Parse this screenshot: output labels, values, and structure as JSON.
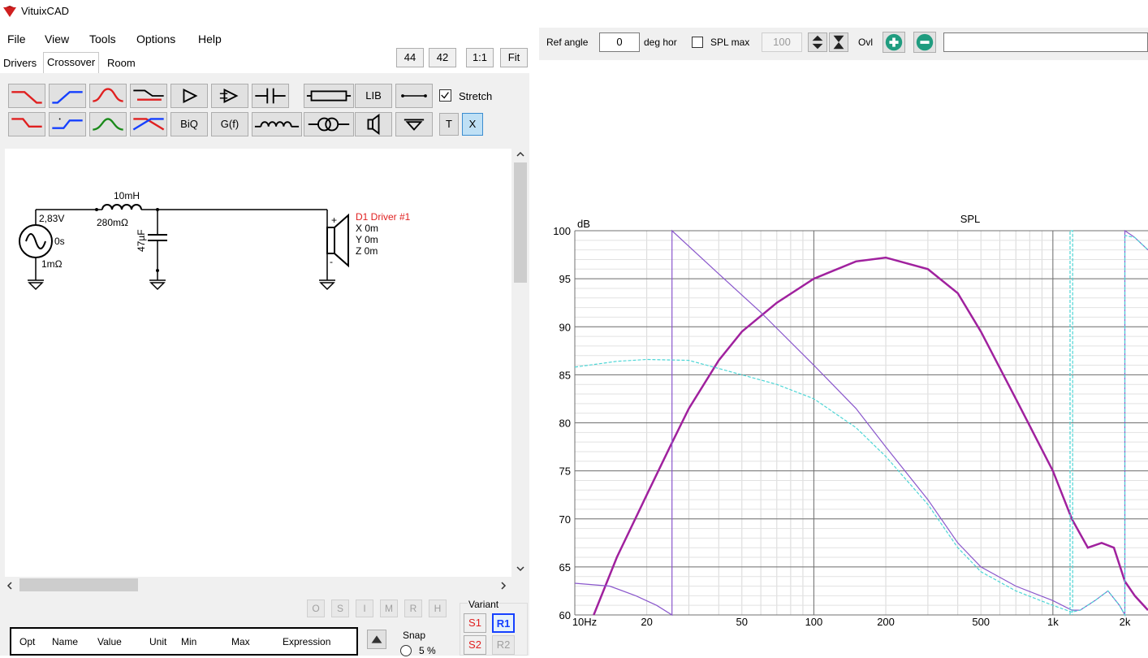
{
  "app": {
    "title": "VituixCAD",
    "logo_icon": "vituixcad-logo-icon"
  },
  "menu": {
    "file": "File",
    "view": "View",
    "tools": "Tools",
    "options": "Options",
    "help": "Help"
  },
  "tabs": {
    "drivers": "Drivers",
    "crossover": "Crossover",
    "room": "Room"
  },
  "top_buttons": {
    "b44": "44",
    "b42": "42",
    "one_to_one": "1:1",
    "fit": "Fit"
  },
  "toolbar": {
    "lib": "LIB",
    "biq": "BiQ",
    "gf": "G(f)",
    "t": "T",
    "x": "X",
    "stretch_label": "Stretch",
    "stretch_checked": true
  },
  "schematic": {
    "source_voltage": "2,83V",
    "source_delay": "0s",
    "source_resistance": "1mΩ",
    "inductor_value": "10mH",
    "inductor_resistance": "280mΩ",
    "capacitor_value": "47µF",
    "driver_name": "D1 Driver #1",
    "driver_x": "X 0m",
    "driver_y": "Y 0m",
    "driver_z": "Z 0m",
    "plus": "+",
    "minus": "-"
  },
  "opt_buttons": [
    "O",
    "S",
    "I",
    "M",
    "R",
    "H"
  ],
  "variant": {
    "label": "Variant",
    "s1": "S1",
    "r1": "R1",
    "s2": "S2",
    "r2": "R2"
  },
  "snap": {
    "label": "Snap",
    "option": "5 %"
  },
  "table": {
    "headers": [
      "Opt",
      "Name",
      "Value",
      "Unit",
      "Min",
      "Max",
      "Expression"
    ]
  },
  "response_toolbar": {
    "ref_angle_label": "Ref angle",
    "ref_angle_value": "0",
    "deg_hor_label": "deg hor",
    "spl_max_label": "SPL max",
    "spl_max_checked": false,
    "spl_max_value": "100",
    "ovl_label": "Ovl",
    "overlay_text": ""
  },
  "colors": {
    "total": "#a0219e",
    "response": "#8a57cc",
    "cyan": "#4dd6d6",
    "red": "#e02020",
    "blue": "#1540ff",
    "green": "#1a8a1a"
  },
  "chart_data": {
    "type": "line",
    "title": "SPL",
    "ylabel": "dB",
    "xlabel": "",
    "x_scale": "log",
    "xlim": [
      10,
      2500
    ],
    "ylim": [
      60,
      100
    ],
    "x_tick_labels": [
      "10Hz",
      "20",
      "50",
      "100",
      "200",
      "500",
      "1k",
      "2k"
    ],
    "x_ticks": [
      10,
      20,
      50,
      100,
      200,
      500,
      1000,
      2000
    ],
    "y_ticks": [
      60,
      65,
      70,
      75,
      80,
      85,
      90,
      95,
      100
    ],
    "grid": true,
    "series": [
      {
        "color": "#a0219e",
        "width": 2.5,
        "dash": "",
        "points": [
          [
            12,
            60
          ],
          [
            15,
            66
          ],
          [
            20,
            72.5
          ],
          [
            25,
            77.5
          ],
          [
            30,
            81.5
          ],
          [
            40,
            86.5
          ],
          [
            50,
            89.5
          ],
          [
            70,
            92.5
          ],
          [
            100,
            95
          ],
          [
            150,
            96.8
          ],
          [
            200,
            97.2
          ],
          [
            300,
            96
          ],
          [
            400,
            93.5
          ],
          [
            500,
            89.5
          ],
          [
            700,
            82.5
          ],
          [
            1000,
            75
          ],
          [
            1200,
            70
          ],
          [
            1400,
            67
          ],
          [
            1600,
            67.5
          ],
          [
            1800,
            67
          ],
          [
            2000,
            63.5
          ],
          [
            2200,
            62
          ],
          [
            2500,
            60.5
          ]
        ]
      },
      {
        "color": "#8a57cc",
        "width": 1.2,
        "dash": "",
        "points": [
          [
            10,
            63.3
          ],
          [
            14,
            63
          ],
          [
            18,
            62
          ],
          [
            22,
            61
          ],
          [
            25.5,
            60
          ],
          [
            25.5,
            100
          ],
          [
            40,
            95.5
          ],
          [
            60,
            91.5
          ],
          [
            100,
            86
          ],
          [
            150,
            81.5
          ],
          [
            200,
            77.5
          ],
          [
            300,
            72
          ],
          [
            400,
            67.5
          ],
          [
            500,
            65
          ],
          [
            700,
            63
          ],
          [
            1000,
            61.5
          ],
          [
            1200,
            60.5
          ],
          [
            1300,
            60.5
          ],
          [
            1500,
            61.5
          ],
          [
            1700,
            62.5
          ],
          [
            1900,
            61
          ],
          [
            2000,
            60
          ],
          [
            2000,
            100
          ],
          [
            2200,
            99.3
          ],
          [
            2500,
            98
          ]
        ]
      },
      {
        "color": "#4dd6d6",
        "width": 1.2,
        "dash": "4,2",
        "points": [
          [
            10,
            85.8
          ],
          [
            15,
            86.4
          ],
          [
            20,
            86.6
          ],
          [
            30,
            86.5
          ],
          [
            50,
            85
          ],
          [
            70,
            84
          ],
          [
            100,
            82.5
          ],
          [
            150,
            79.5
          ],
          [
            200,
            76.5
          ],
          [
            300,
            71.5
          ],
          [
            400,
            67
          ],
          [
            500,
            64.5
          ],
          [
            700,
            62.5
          ],
          [
            1000,
            61
          ],
          [
            1200,
            60.3
          ],
          [
            1300,
            60.5
          ],
          [
            1500,
            61.5
          ],
          [
            1700,
            62.5
          ],
          [
            1900,
            61
          ],
          [
            2000,
            60
          ],
          [
            2000,
            99.5
          ],
          [
            2200,
            99.3
          ],
          [
            2500,
            98
          ]
        ]
      },
      {
        "color": "#4dd6d6",
        "width": 1.2,
        "dash": "4,2",
        "points": [
          [
            1180,
            60
          ],
          [
            1180,
            100
          ],
          [
            1210,
            100
          ],
          [
            1210,
            60
          ]
        ]
      }
    ]
  }
}
